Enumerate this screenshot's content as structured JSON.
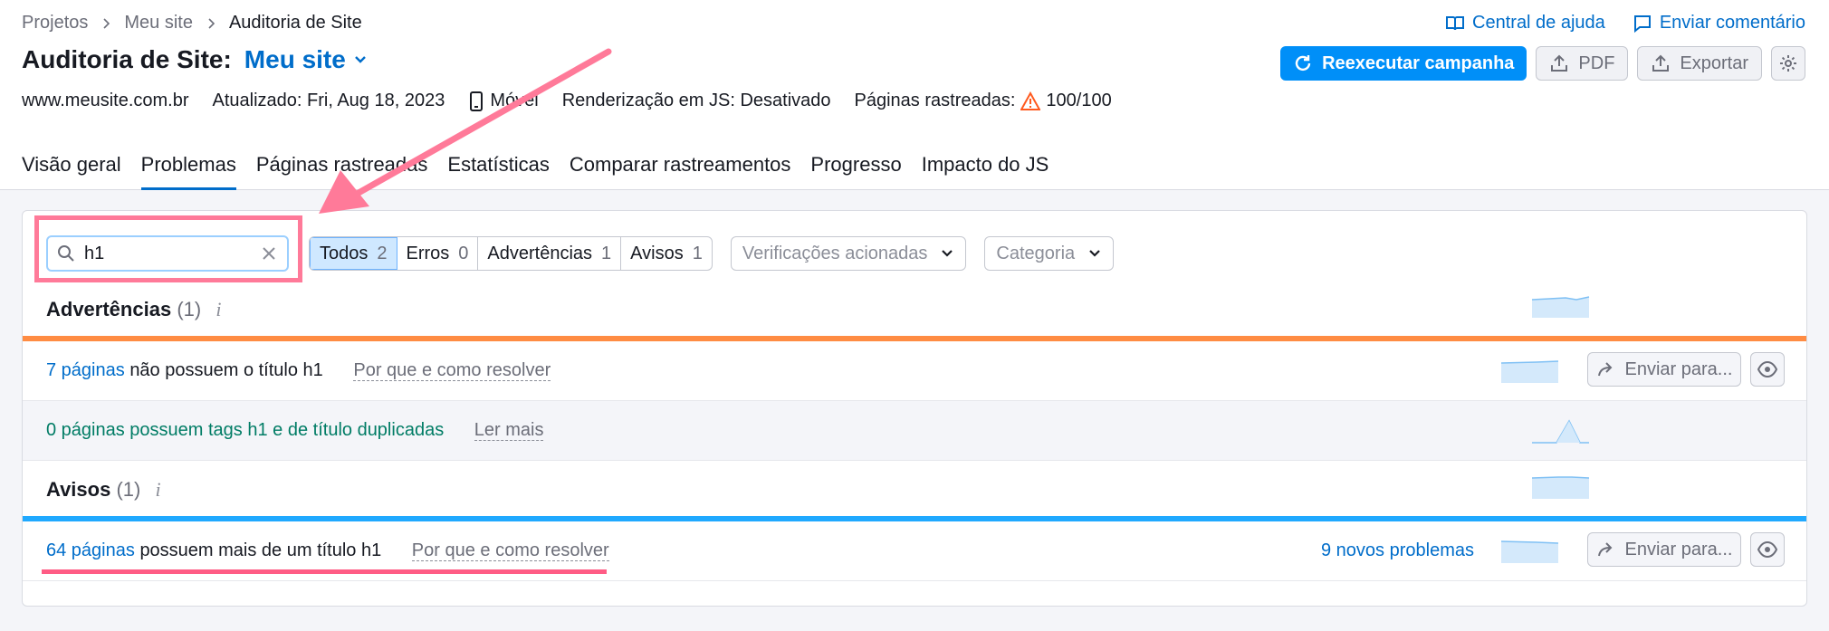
{
  "breadcrumbs": [
    "Projetos",
    "Meu site",
    "Auditoria de Site"
  ],
  "top_links": {
    "help": "Central de ajuda",
    "feedback": "Enviar comentário"
  },
  "title": {
    "label": "Auditoria de Site:",
    "project": "Meu site"
  },
  "actions": {
    "rerun": "Reexecutar campanha",
    "pdf": "PDF",
    "export": "Exportar"
  },
  "meta": {
    "domain": "www.meusite.com.br",
    "updated": "Atualizado: Fri, Aug 18, 2023",
    "device": "Móvel",
    "js_render": "Renderização em JS: Desativado",
    "pages_crawled_label": "Páginas rastreadas:",
    "pages_crawled_value": "100/100"
  },
  "tabs": [
    "Visão geral",
    "Problemas",
    "Páginas rastreadas",
    "Estatísticas",
    "Comparar rastreamentos",
    "Progresso",
    "Impacto do JS"
  ],
  "active_tab": "Problemas",
  "search": {
    "value": "h1"
  },
  "filters": [
    {
      "label": "Todos",
      "count": "2",
      "active": true
    },
    {
      "label": "Erros",
      "count": "0"
    },
    {
      "label": "Advertências",
      "count": "1"
    },
    {
      "label": "Avisos",
      "count": "1"
    }
  ],
  "dropdowns": {
    "checks": "Verificações acionadas",
    "category": "Categoria"
  },
  "sections": {
    "warnings": {
      "title": "Advertências",
      "count": "(1)",
      "info": "i"
    },
    "notices": {
      "title": "Avisos",
      "count": "(1)",
      "info": "i"
    }
  },
  "issues": [
    {
      "link": "7 páginas",
      "text": "não possuem o título h1",
      "help": "Por que e como resolver",
      "send": "Enviar para..."
    },
    {
      "text": "0 páginas possuem tags h1 e de título duplicadas",
      "help": "Ler mais"
    },
    {
      "link": "64 páginas",
      "text": "possuem mais de um título h1",
      "help": "Por que e como resolver",
      "new": "9 novos problemas",
      "send": "Enviar para..."
    }
  ],
  "colors": {
    "accent": "#006dca",
    "primary_button": "#008ff8",
    "warning_bar": "#ff8c43",
    "notice_bar": "#20a9ff",
    "annotation": "#ff7a99",
    "green_text": "#007c65"
  },
  "icons": [
    "chevron-right-icon",
    "book-icon",
    "comment-icon",
    "chevron-down-icon",
    "refresh-icon",
    "upload-icon",
    "gear-icon",
    "phone-icon",
    "warning-icon",
    "search-icon",
    "close-icon",
    "share-arrow-icon",
    "eye-icon"
  ]
}
